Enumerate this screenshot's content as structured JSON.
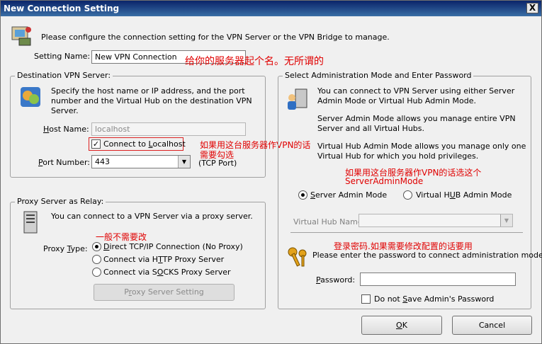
{
  "window": {
    "title": "New Connection Setting",
    "close_glyph": "X"
  },
  "intro": "Please configure the connection setting for the VPN Server or the VPN Bridge to manage.",
  "setting_name": {
    "label": "Setting Name:",
    "value": "New VPN Connection"
  },
  "destination": {
    "group_title": "Destination VPN Server:",
    "description": "Specify the host name or IP address, and the port number and the Virtual Hub on the destination VPN Server.",
    "host_label": "Host Name:",
    "host_value": "localhost",
    "connect_localhost_label": "Connect to Localhost",
    "connect_localhost_checked": true,
    "port_label": "Port Number:",
    "port_value": "443",
    "port_note": "(TCP Port)"
  },
  "proxy": {
    "group_title": "Proxy Server as Relay:",
    "description": "You can connect to a VPN Server via a proxy server.",
    "type_label": "Proxy Type:",
    "options": [
      "Direct TCP/IP Connection (No Proxy)",
      "Connect via HTTP Proxy Server",
      "Connect via SOCKS Proxy Server"
    ],
    "selected_index": 0,
    "setting_button": "Proxy Server Setting"
  },
  "admin": {
    "group_title": "Select Administration Mode and Enter Password",
    "desc1": "You can connect to VPN Server using either Server Admin Mode or Virtual Hub Admin Mode.",
    "desc2": "Server Admin Mode allows you manage entire VPN Server and all Virtual Hubs.",
    "desc3": "Virtual Hub Admin Mode allows you manage only one Virtual Hub for which you hold privileges.",
    "mode_server": "Server Admin Mode",
    "mode_hub": "Virtual HUB Admin Mode",
    "hub_name_label": "Virtual Hub Name:",
    "password_prompt": "Please enter the password to connect administration mode.",
    "password_label": "Password:",
    "password_value": "",
    "dont_save_label": "Do not Save Admin's Password"
  },
  "buttons": {
    "ok": "OK",
    "cancel": "Cancel"
  },
  "annotations": {
    "name_note": "给你的服务器起个名。无所谓的",
    "localhost_note_1": "如果用这台服务器作VPN的话",
    "localhost_note_2": "需要勾选",
    "proxy_note": "一般不需要改",
    "mode_note_1": "如果用这台服务器作VPN的话选这个",
    "mode_note_2": "ServerAdminMode",
    "password_note": "登录密码.如果需要修改配置的话要用"
  },
  "colors": {
    "annotation": "#e00000",
    "title_bar": "#0a246a"
  }
}
